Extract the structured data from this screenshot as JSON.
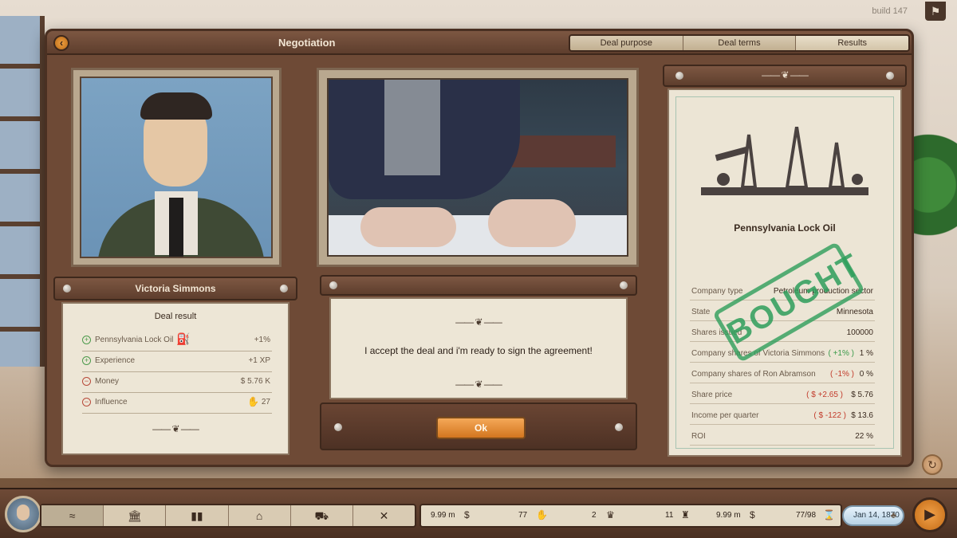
{
  "build": "build 147",
  "window": {
    "title": "Negotiation",
    "tabs": [
      "Deal purpose",
      "Deal terms",
      "Results"
    ],
    "active_tab": 2
  },
  "person": {
    "name": "Victoria Simmons"
  },
  "deal_result": {
    "title": "Deal result",
    "rows": [
      {
        "sign": "+",
        "label": "Pennsylvania Lock Oil",
        "value": "+1%",
        "icon": "oil-pump-icon"
      },
      {
        "sign": "+",
        "label": "Experience",
        "value": "+1 XP"
      },
      {
        "sign": "-",
        "label": "Money",
        "value": "$ 5.76 K"
      },
      {
        "sign": "-",
        "label": "Influence",
        "value": "27",
        "icon": "influence-hand-icon"
      }
    ]
  },
  "dialog": {
    "text": "I accept the deal and i'm ready to sign the agreement!",
    "ok_label": "Ok"
  },
  "certificate": {
    "company": "Pennsylvania Lock Oil",
    "stamp": "BOUGHT",
    "rows": [
      {
        "key": "Company type",
        "value": "Petroleum production sector",
        "change": "",
        "change_kind": ""
      },
      {
        "key": "State",
        "value": "Minnesota",
        "change": "",
        "change_kind": ""
      },
      {
        "key": "Shares issued",
        "value": "100000",
        "change": "",
        "change_kind": ""
      },
      {
        "key": "Company shares of Victoria Simmons",
        "value": "1 %",
        "change": "( +1% )",
        "change_kind": "pos"
      },
      {
        "key": "Company shares of Ron Abramson",
        "value": "0 %",
        "change": "( -1% )",
        "change_kind": "neg"
      },
      {
        "key": "Share price",
        "value": "$ 5.76",
        "change": "( $ +2.65 )",
        "change_kind": "neg"
      },
      {
        "key": "Income per quarter",
        "value": "$ 13.6",
        "change": "( $ -122 )",
        "change_kind": "neg"
      },
      {
        "key": "ROI",
        "value": "22 %",
        "change": "",
        "change_kind": ""
      }
    ]
  },
  "bottom_bar": {
    "nav": [
      "map-icon",
      "bank-icon",
      "chart-icon",
      "capitol-icon",
      "car-icon",
      "network-icon"
    ],
    "stats": {
      "money": "9.99 m",
      "influence": "77",
      "prestige": "2",
      "tower": "11",
      "cash": "9.99 m",
      "turns": "77/98"
    },
    "date": "Jan 14, 1870"
  },
  "colors": {
    "accent_orange": "#d3761f",
    "stamp_green": "#2e9e5a",
    "positive": "#3a9a4a",
    "negative": "#c23a2a"
  }
}
